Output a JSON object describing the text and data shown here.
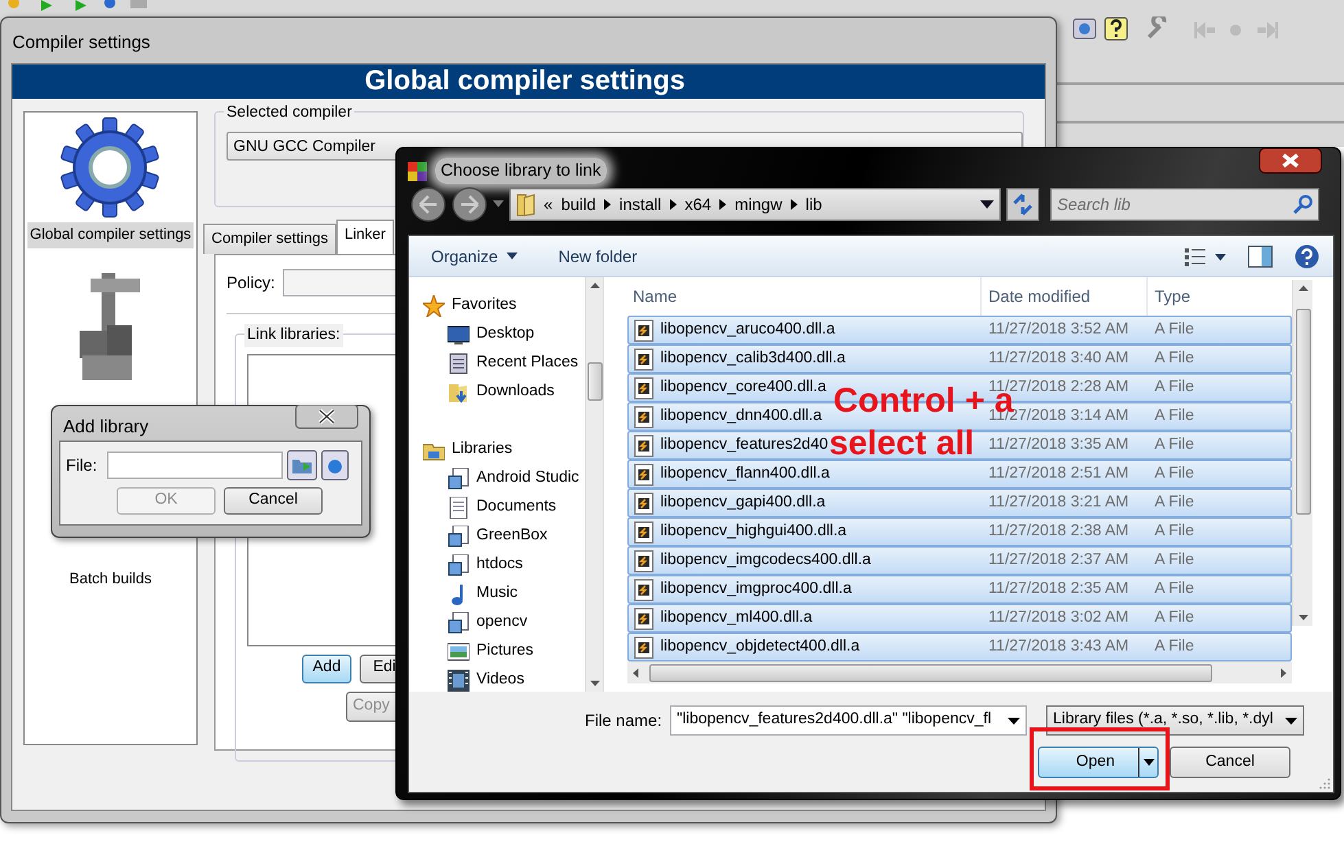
{
  "compiler_window": {
    "title": "Compiler settings",
    "header": "Global compiler settings",
    "sidebar": {
      "items": [
        {
          "kind": "gear",
          "label": "Global compiler settings",
          "selected": true
        },
        {
          "kind": "caliper",
          "selected": false
        },
        {
          "kind": "batch",
          "label": "Batch builds",
          "selected": false
        }
      ]
    },
    "selected_compiler": {
      "legend": "Selected compiler",
      "value": "GNU GCC Compiler"
    },
    "tabs": [
      {
        "label": "Compiler settings",
        "selected": false
      },
      {
        "label": "Linker",
        "selected": true
      }
    ],
    "policy_label": "Policy:",
    "link_libraries": {
      "legend": "Link libraries:",
      "buttons": [
        {
          "label": "Add",
          "focused": true
        },
        {
          "label": "Edi",
          "focused": false
        }
      ],
      "copy_button": "Copy"
    }
  },
  "add_library_dialog": {
    "title": "Add library",
    "file_label": "File:",
    "buttons": [
      {
        "label": "OK",
        "disabled": true
      },
      {
        "label": "Cancel",
        "disabled": false
      }
    ]
  },
  "choose_dialog": {
    "title": "Choose library to link",
    "path_prefix": "«",
    "path": [
      "build",
      "install",
      "x64",
      "mingw",
      "lib"
    ],
    "search_placeholder": "Search lib",
    "toolbar": [
      {
        "label": "Organize",
        "dropdown": true
      },
      {
        "label": "New folder",
        "dropdown": false
      }
    ],
    "nav": [
      {
        "kind": "star",
        "label": "Favorites",
        "children": [
          {
            "kind": "desktop",
            "label": "Desktop"
          },
          {
            "kind": "recent",
            "label": "Recent Places"
          },
          {
            "kind": "downloads",
            "label": "Downloads"
          }
        ]
      },
      {
        "kind": "library",
        "label": "Libraries",
        "children": [
          {
            "kind": "library-doc",
            "label": "Android Studic"
          },
          {
            "kind": "document",
            "label": "Documents"
          },
          {
            "kind": "library-doc",
            "label": "GreenBox"
          },
          {
            "kind": "library-doc",
            "label": "htdocs"
          },
          {
            "kind": "music",
            "label": "Music"
          },
          {
            "kind": "library-doc",
            "label": "opencv"
          },
          {
            "kind": "pictures",
            "label": "Pictures"
          },
          {
            "kind": "videos",
            "label": "Videos"
          }
        ]
      }
    ],
    "columns": [
      "Name",
      "Date modified",
      "Type"
    ],
    "rows": [
      {
        "name": "libopencv_aruco400.dll.a",
        "date": "11/27/2018 3:52 AM",
        "type": "A File",
        "selected": true
      },
      {
        "name": "libopencv_calib3d400.dll.a",
        "date": "11/27/2018 3:40 AM",
        "type": "A File",
        "selected": true
      },
      {
        "name": "libopencv_core400.dll.a",
        "date": "11/27/2018 2:28 AM",
        "type": "A File",
        "selected": true
      },
      {
        "name": "libopencv_dnn400.dll.a",
        "date": "11/27/2018 3:14 AM",
        "type": "A File",
        "selected": true
      },
      {
        "name": "libopencv_features2d40",
        "date": "11/27/2018 3:35 AM",
        "type": "A File",
        "selected": true
      },
      {
        "name": "libopencv_flann400.dll.a",
        "date": "11/27/2018 2:51 AM",
        "type": "A File",
        "selected": true
      },
      {
        "name": "libopencv_gapi400.dll.a",
        "date": "11/27/2018 3:21 AM",
        "type": "A File",
        "selected": true
      },
      {
        "name": "libopencv_highgui400.dll.a",
        "date": "11/27/2018 2:38 AM",
        "type": "A File",
        "selected": true
      },
      {
        "name": "libopencv_imgcodecs400.dll.a",
        "date": "11/27/2018 2:37 AM",
        "type": "A File",
        "selected": true
      },
      {
        "name": "libopencv_imgproc400.dll.a",
        "date": "11/27/2018 2:35 AM",
        "type": "A File",
        "selected": true
      },
      {
        "name": "libopencv_ml400.dll.a",
        "date": "11/27/2018 3:02 AM",
        "type": "A File",
        "selected": true
      },
      {
        "name": "libopencv_objdetect400.dll.a",
        "date": "11/27/2018 3:43 AM",
        "type": "A File",
        "selected": true
      }
    ],
    "file_name_label": "File name:",
    "file_name_value": "\"libopencv_features2d400.dll.a\" \"libopencv_fl",
    "filter": "Library files (*.a, *.so, *.lib, *.dyl",
    "buttons": [
      {
        "label": "Open",
        "kind": "split"
      },
      {
        "label": "Cancel",
        "kind": "plain"
      }
    ]
  },
  "annotation": {
    "lines": [
      "Control + a",
      "select all"
    ]
  }
}
